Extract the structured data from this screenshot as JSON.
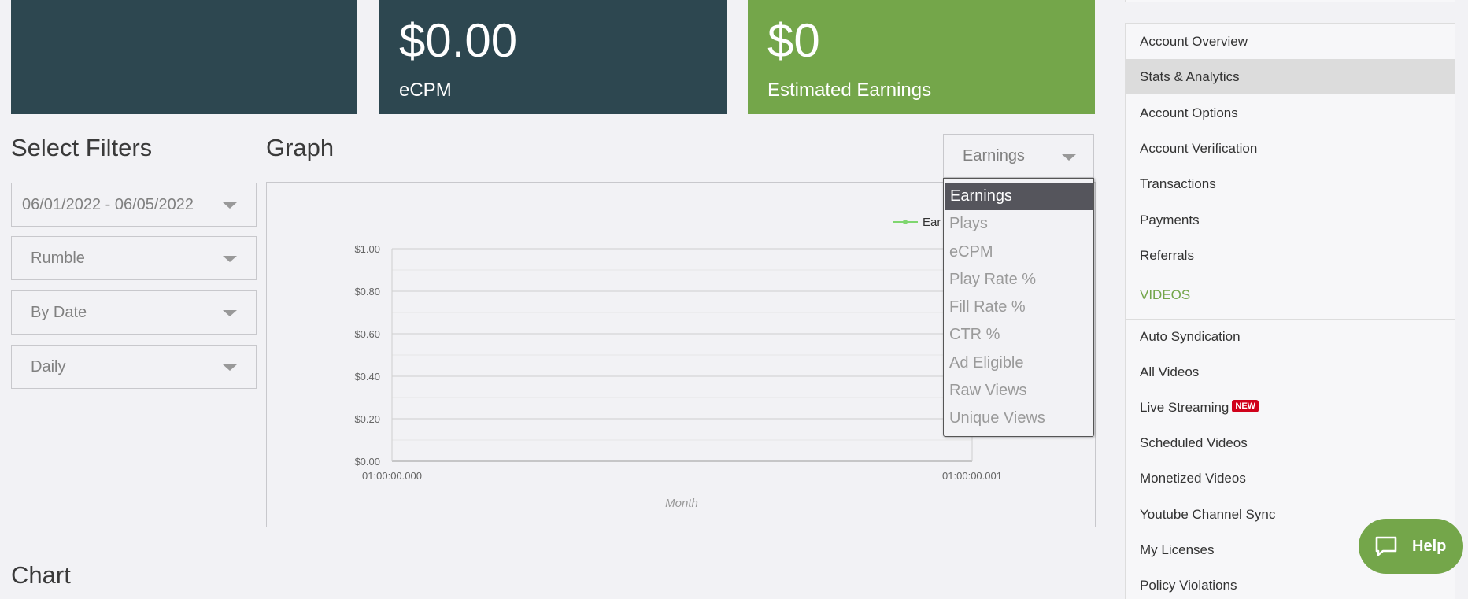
{
  "stats": {
    "ecpm_value": "$0.00",
    "ecpm_label": "eCPM",
    "earnings_value": "$0",
    "earnings_label": "Estimated Earnings"
  },
  "filters": {
    "title": "Select Filters",
    "date_range": "06/01/2022 - 06/05/2022",
    "platform": "Rumble",
    "group_by": "By Date",
    "interval": "Daily"
  },
  "graph": {
    "title": "Graph",
    "metric_selected": "Earnings",
    "metric_options": [
      "Earnings",
      "Plays",
      "eCPM",
      "Play Rate %",
      "Fill Rate %",
      "CTR %",
      "Ad Eligible",
      "Raw Views",
      "Unique Views"
    ]
  },
  "chart_data": {
    "type": "line",
    "title": "",
    "xlabel": "Month",
    "ylabel": "",
    "x_tick_labels": [
      "01:00:00.000",
      "01:00:00.001"
    ],
    "y_tick_labels": [
      "$0.00",
      "$0.20",
      "$0.40",
      "$0.60",
      "$0.80",
      "$1.00"
    ],
    "ylim": [
      0,
      1
    ],
    "grid": true,
    "legend_position": "top-right",
    "legend_visible_text": "Ear",
    "series": [
      {
        "name": "Earnings",
        "color": "#7fd66f",
        "values": []
      }
    ]
  },
  "chart_section": {
    "title": "Chart"
  },
  "sidebar": {
    "items": [
      {
        "label": "Account Overview"
      },
      {
        "label": "Stats & Analytics"
      },
      {
        "label": "Account Options"
      },
      {
        "label": "Account Verification"
      },
      {
        "label": "Transactions"
      },
      {
        "label": "Payments"
      },
      {
        "label": "Referrals"
      }
    ],
    "videos_heading": "VIDEOS",
    "video_items": [
      {
        "label": "Auto Syndication"
      },
      {
        "label": "All Videos"
      },
      {
        "label": "Live Streaming",
        "badge": "NEW"
      },
      {
        "label": "Scheduled Videos"
      },
      {
        "label": "Monetized Videos"
      },
      {
        "label": "Youtube Channel Sync"
      },
      {
        "label": "My Licenses"
      },
      {
        "label": "Policy Violations"
      }
    ]
  },
  "help": {
    "label": "Help"
  },
  "colors": {
    "dark_card": "#2d4750",
    "accent_green": "#74a64a",
    "badge_red": "#d0021b"
  }
}
